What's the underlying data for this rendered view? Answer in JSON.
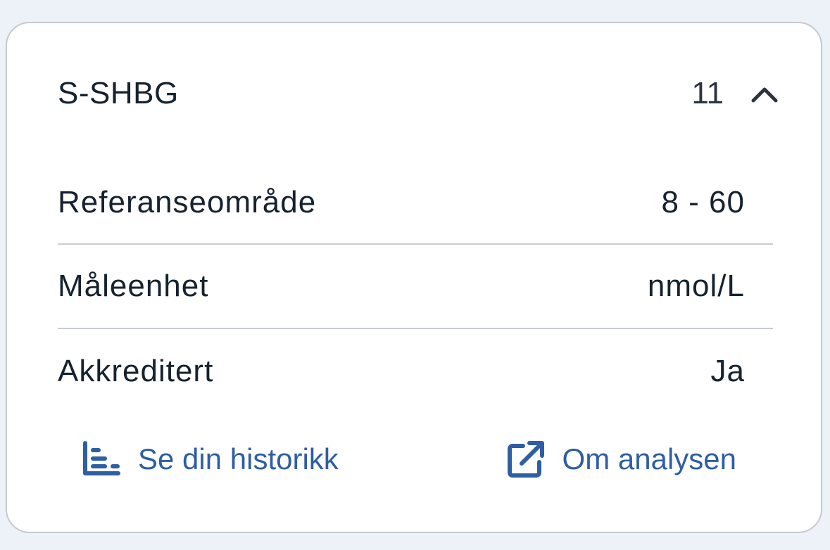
{
  "analysis": {
    "name": "S-SHBG",
    "result": "11",
    "expanded_icon": "chevron-up-icon"
  },
  "details": [
    {
      "label": "Referanseområde",
      "value": "8 - 60"
    },
    {
      "label": "Måleenhet",
      "value": "nmol/L"
    },
    {
      "label": "Akkreditert",
      "value": "Ja"
    }
  ],
  "links": {
    "history": {
      "label": "Se din historikk",
      "icon": "history-chart-icon"
    },
    "about": {
      "label": "Om analysen",
      "icon": "external-link-icon"
    }
  },
  "colors": {
    "background": "#edf1f8",
    "card": "#ffffff",
    "border": "#c6c9d0",
    "text": "#16222f",
    "link": "#2e5ea3"
  }
}
